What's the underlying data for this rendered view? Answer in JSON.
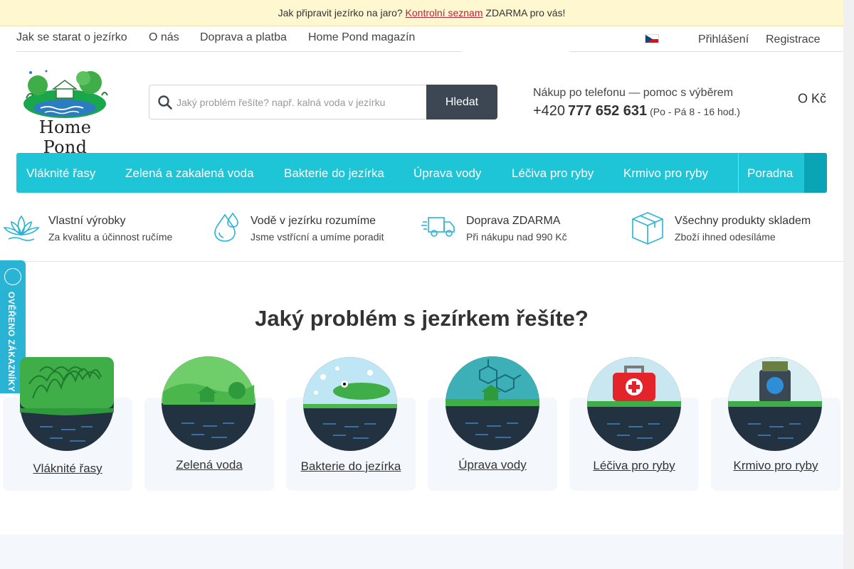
{
  "banner": {
    "icon1": "",
    "text1": "Jak připravit jezírko na jaro?",
    "icon2": "",
    "link": "Kontrolní seznam",
    "text2": "ZDARMA pro vás!",
    "close": ""
  },
  "topnav": {
    "items": [
      "Jak se starat o jezírko",
      "O nás",
      "Doprava a platba",
      "Home Pond magazín"
    ],
    "more_icon": ""
  },
  "account": {
    "lang_caret": "",
    "login_icon": "",
    "login": "Přihlášení",
    "register_icon": "",
    "register": "Registrace"
  },
  "logo": {
    "name": "Home Pond"
  },
  "search": {
    "placeholder": "Jaký problém řešíte? např. kalná voda v jezírku",
    "button": "Hledat"
  },
  "contact": {
    "title": "Nákup po telefonu — pomoc s výběrem",
    "phone_icon": "",
    "prefix": "+420",
    "number": "777 652 631",
    "hours": "(Po - Pá 8 - 16 hod.)"
  },
  "cart": {
    "icon": "",
    "total": "O Kč"
  },
  "mainnav": {
    "arrow": "",
    "categories": [
      "Vláknité řasy",
      "Zelená a zakalená voda",
      "Bakterie do jezírka",
      "Úprava vody",
      "Léčiva pro ryby",
      "Krmivo pro ryby"
    ],
    "poradna_icon": "",
    "poradna": "Poradna",
    "end_icon": ""
  },
  "benefits": [
    {
      "title": "Vlastní výrobky",
      "subtitle": "Za kvalitu a účinnost ručíme",
      "icon": "lotus-icon"
    },
    {
      "title": "Vodě v jezírku rozumíme",
      "subtitle": "Jsme vstřícní a umíme poradit",
      "icon": "water-drops-icon"
    },
    {
      "title": "Doprava ZDARMA",
      "subtitle": "Při nákupu nad 990 Kč",
      "icon": "delivery-truck-icon"
    },
    {
      "title": "Všechny produkty skladem",
      "subtitle": "Zboží ihned odesíláme",
      "icon": "box-icon"
    }
  ],
  "badge": {
    "text": "OVĚŘENO ZÁKAZNÍKY"
  },
  "section": {
    "title": "Jaký problém s jezírkem řešíte?"
  },
  "categories": [
    {
      "label": "Vláknité řasy",
      "icon": "algae-icon"
    },
    {
      "label": "Zelená voda",
      "icon": "green-water-icon"
    },
    {
      "label": "Bakterie do jezírka",
      "icon": "bacteria-icon"
    },
    {
      "label": "Úprava vody",
      "icon": "water-treatment-icon"
    },
    {
      "label": "Léčiva pro ryby",
      "icon": "medicine-icon"
    },
    {
      "label": "Krmivo pro ryby",
      "icon": "fish-food-icon"
    }
  ],
  "colors": {
    "accent": "#1ec5d6",
    "banner_bg": "#fff7cf",
    "button_dark": "#3d4753",
    "cart_green": "#2cb93a",
    "pond_dark": "#223240",
    "grass_green": "#3fae49"
  }
}
